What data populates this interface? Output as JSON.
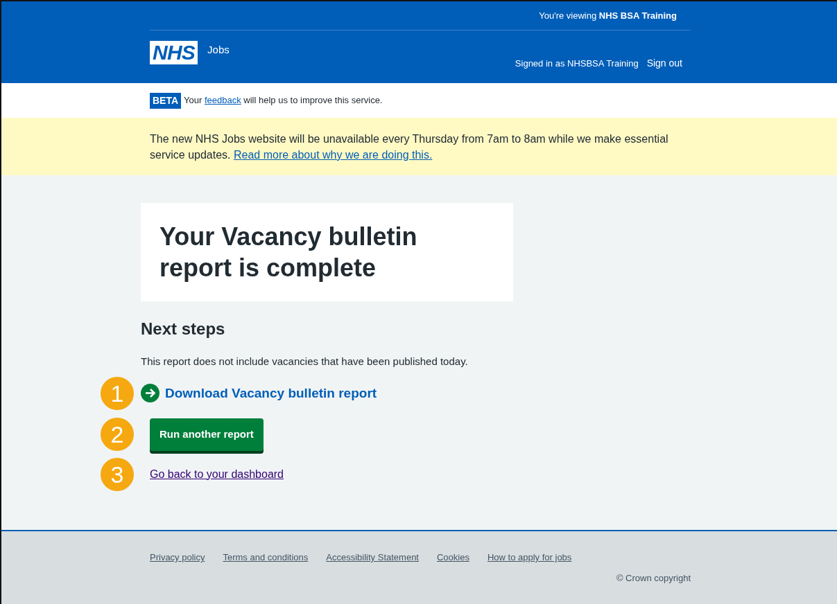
{
  "header": {
    "viewing_prefix": "You're viewing ",
    "viewing_org": "NHS BSA Training",
    "logo": "NHS",
    "service": "Jobs",
    "signed_in": "Signed in as NHSBSA Training",
    "sign_out": "Sign out"
  },
  "phase_banner": {
    "tag": "BETA",
    "text_before": "Your ",
    "link": "feedback",
    "text_after": " will help us to improve this service."
  },
  "notice": {
    "text": "The new NHS Jobs website will be unavailable every Thursday from 7am to 8am while we make essential service updates. ",
    "link": "Read more about why we are doing this."
  },
  "title": "Your Vacancy bulletin report is complete",
  "next_steps": {
    "heading": "Next steps",
    "body": "This report does not include vacancies that have been published today."
  },
  "actions": [
    {
      "kind": "action-link",
      "callout": "1",
      "label": "Download Vacancy bulletin report"
    },
    {
      "kind": "button",
      "callout": "2",
      "label": "Run another report"
    },
    {
      "kind": "link",
      "callout": "3",
      "label": "Go back to your dashboard"
    }
  ],
  "footer": {
    "links": [
      "Privacy policy",
      "Terms and conditions",
      "Accessibility Statement",
      "Cookies",
      "How to apply for jobs"
    ],
    "copyright": "© Crown copyright"
  }
}
